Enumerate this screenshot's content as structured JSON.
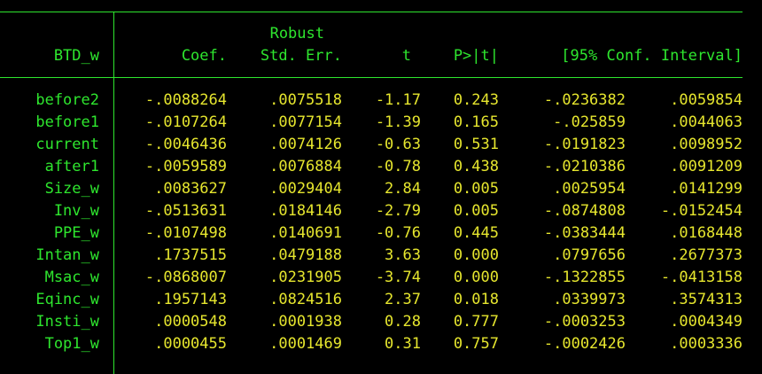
{
  "colors": {
    "background": "#000000",
    "label": "#2ee62e",
    "value": "#e6e62e",
    "rule": "#2ee62e"
  },
  "header": {
    "depvar": "BTD_w",
    "robust": "Robust",
    "coef": "Coef.",
    "se": "Std. Err.",
    "t": "t",
    "p": "P>|t|",
    "ci": "[95% Conf. Interval]"
  },
  "rows": [
    {
      "var": "before2",
      "coef": "-.0088264",
      "se": ".0075518",
      "t": "-1.17",
      "p": "0.243",
      "lo": "-.0236382",
      "hi": ".0059854"
    },
    {
      "var": "before1",
      "coef": "-.0107264",
      "se": ".0077154",
      "t": "-1.39",
      "p": "0.165",
      "lo": "-.025859",
      "hi": ".0044063"
    },
    {
      "var": "current",
      "coef": "-.0046436",
      "se": ".0074126",
      "t": "-0.63",
      "p": "0.531",
      "lo": "-.0191823",
      "hi": ".0098952"
    },
    {
      "var": "after1",
      "coef": "-.0059589",
      "se": ".0076884",
      "t": "-0.78",
      "p": "0.438",
      "lo": "-.0210386",
      "hi": ".0091209"
    },
    {
      "var": "Size_w",
      "coef": ".0083627",
      "se": ".0029404",
      "t": "2.84",
      "p": "0.005",
      "lo": ".0025954",
      "hi": ".0141299"
    },
    {
      "var": "Inv_w",
      "coef": "-.0513631",
      "se": ".0184146",
      "t": "-2.79",
      "p": "0.005",
      "lo": "-.0874808",
      "hi": "-.0152454"
    },
    {
      "var": "PPE_w",
      "coef": "-.0107498",
      "se": ".0140691",
      "t": "-0.76",
      "p": "0.445",
      "lo": "-.0383444",
      "hi": ".0168448"
    },
    {
      "var": "Intan_w",
      "coef": ".1737515",
      "se": ".0479188",
      "t": "3.63",
      "p": "0.000",
      "lo": ".0797656",
      "hi": ".2677373"
    },
    {
      "var": "Msac_w",
      "coef": "-.0868007",
      "se": ".0231905",
      "t": "-3.74",
      "p": "0.000",
      "lo": "-.1322855",
      "hi": "-.0413158"
    },
    {
      "var": "Eqinc_w",
      "coef": ".1957143",
      "se": ".0824516",
      "t": "2.37",
      "p": "0.018",
      "lo": ".0339973",
      "hi": ".3574313"
    },
    {
      "var": "Insti_w",
      "coef": ".0000548",
      "se": ".0001938",
      "t": "0.28",
      "p": "0.777",
      "lo": "-.0003253",
      "hi": ".0004349"
    },
    {
      "var": "Top1_w",
      "coef": ".0000455",
      "se": ".0001469",
      "t": "0.31",
      "p": "0.757",
      "lo": "-.0002426",
      "hi": ".0003336"
    }
  ]
}
